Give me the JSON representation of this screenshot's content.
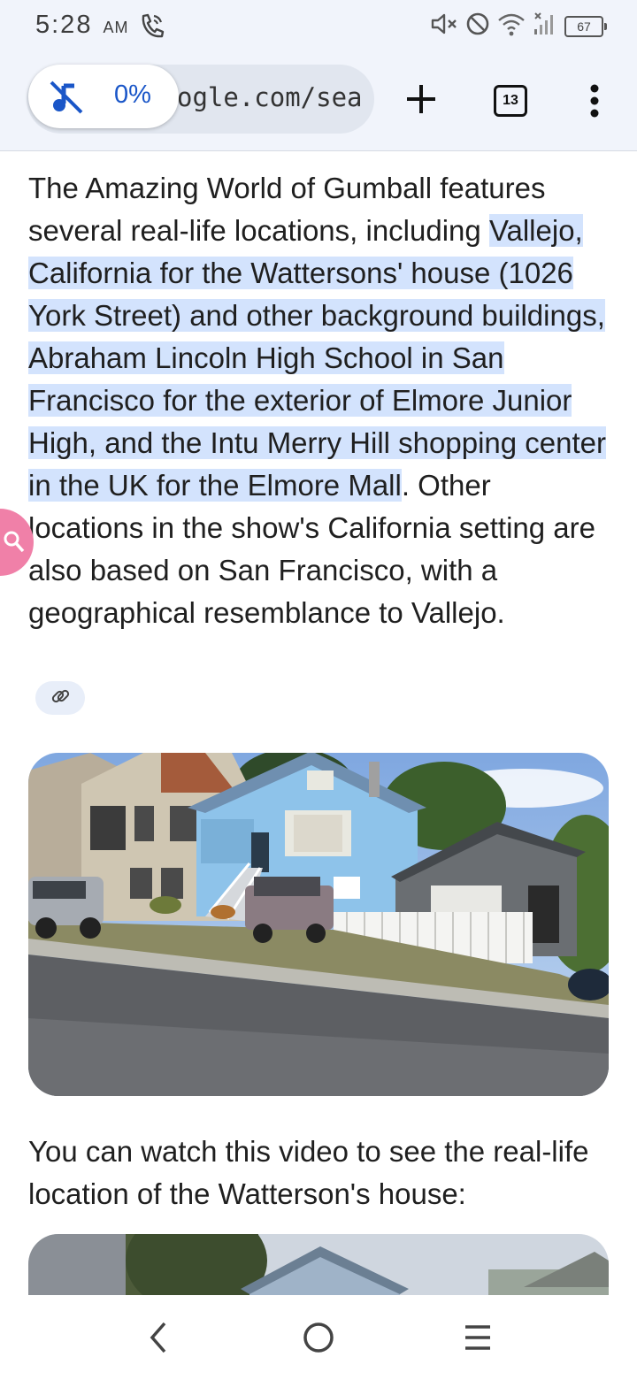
{
  "status_bar": {
    "time": "5:28",
    "ampm": "AM",
    "battery": "67",
    "icons": [
      "phone-call-icon",
      "volume-mute-icon",
      "do-not-disturb-icon",
      "wifi-icon",
      "signal-icon",
      "battery-icon"
    ]
  },
  "toolbar": {
    "url": "google.com/sea",
    "url_visible": "ogle.com/sea",
    "media_percent": "0%",
    "tab_count": "13",
    "icons": [
      "mute-icon",
      "plus-icon",
      "tabs-icon",
      "more-vert-icon"
    ]
  },
  "content": {
    "answer": {
      "intro": "The Amazing World of Gumball features several real-life locations, including",
      "highlight": "Vallejo, California for the Wattersons' house (1026 York Street) and other background buildings, Abraham Lincoln High School in San Francisco for the exterior of Elmore Junior High, and the Intu Merry Hill shopping center in the UK for the Elmore Mall",
      "rest": ". Other locations in the show's California setting are also based on San Francisco, with a geographical resemblance to Vallejo."
    },
    "video_text": "You can watch this video to see the real-life location of the Watterson's house:",
    "icons": [
      "link-icon",
      "lens-search-icon"
    ]
  },
  "nav_bar": {
    "icons": [
      "back-icon",
      "home-icon",
      "recents-icon"
    ]
  },
  "colors": {
    "highlight": "#d3e3fd",
    "toolbar_bg": "#f1f4fb",
    "accent": "#1a56c8",
    "lens_fab": "#f080a8"
  }
}
